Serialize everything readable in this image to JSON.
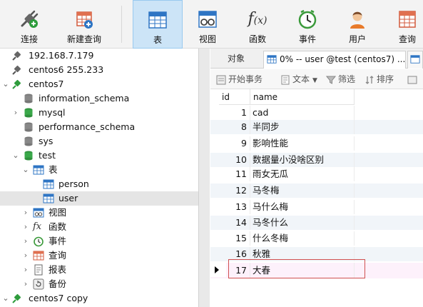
{
  "toolbar": {
    "items": [
      {
        "label": "连接",
        "icon": "connect-plug-icon"
      },
      {
        "label": "新建查询",
        "icon": "new-query-icon"
      },
      {
        "label": "表",
        "icon": "table-icon"
      },
      {
        "label": "视图",
        "icon": "view-icon"
      },
      {
        "label": "函数",
        "icon": "function-icon"
      },
      {
        "label": "事件",
        "icon": "event-clock-icon"
      },
      {
        "label": "用户",
        "icon": "user-icon"
      },
      {
        "label": "查询",
        "icon": "query-icon"
      }
    ],
    "active": "表"
  },
  "tree": {
    "items": [
      {
        "label": "192.168.7.179",
        "icon": "mysql-connection-icon",
        "state": "closed"
      },
      {
        "label": "centos6 255.233",
        "icon": "mysql-connection-icon",
        "state": "closed"
      },
      {
        "label": "centos7",
        "icon": "mysql-connection-icon",
        "state": "open"
      },
      {
        "label": "information_schema",
        "icon": "database-icon",
        "state": "closed"
      },
      {
        "label": "mysql",
        "icon": "database-icon",
        "state": "closed"
      },
      {
        "label": "performance_schema",
        "icon": "database-icon",
        "state": "closed"
      },
      {
        "label": "sys",
        "icon": "database-icon",
        "state": "closed"
      },
      {
        "label": "test",
        "icon": "database-icon",
        "state": "open"
      },
      {
        "label": "表",
        "icon": "table-icon",
        "state": "open"
      },
      {
        "label": "person",
        "icon": "table-icon",
        "state": "leaf"
      },
      {
        "label": "user",
        "icon": "table-icon",
        "state": "selected"
      },
      {
        "label": "视图",
        "icon": "view-icon",
        "state": "closed"
      },
      {
        "label": "函数",
        "icon": "function-icon",
        "state": "closed"
      },
      {
        "label": "事件",
        "icon": "event-clock-icon",
        "state": "closed"
      },
      {
        "label": "查询",
        "icon": "query-icon",
        "state": "closed"
      },
      {
        "label": "报表",
        "icon": "report-icon",
        "state": "closed"
      },
      {
        "label": "备份",
        "icon": "backup-icon",
        "state": "closed"
      },
      {
        "label": "centos7 copy",
        "icon": "mysql-connection-icon",
        "state": "open"
      }
    ]
  },
  "tabs": {
    "objects": "对象",
    "active": "0% -- user @test (centos7) ..."
  },
  "subbar": {
    "begin_transaction": "开始事务",
    "text": "文本",
    "filter": "筛选",
    "sort": "排序"
  },
  "grid": {
    "headers": [
      "id",
      "name"
    ],
    "rows": [
      {
        "id": "1",
        "name": "cad"
      },
      {
        "id": "8",
        "name": "半同步"
      },
      {
        "id": "9",
        "name": "影响性能"
      },
      {
        "id": "10",
        "name": "数据量小没啥区别"
      },
      {
        "id": "11",
        "name": "雨女无瓜"
      },
      {
        "id": "12",
        "name": "马冬梅"
      },
      {
        "id": "13",
        "name": "马什么梅"
      },
      {
        "id": "14",
        "name": "马冬什么"
      },
      {
        "id": "15",
        "name": "什么冬梅"
      },
      {
        "id": "16",
        "name": "秋雅"
      },
      {
        "id": "17",
        "name": "大春"
      }
    ],
    "current_row": "17"
  },
  "colors": {
    "accent": "#cce4f7",
    "db_green": "#3aa84a",
    "table_blue": "#2e75c4",
    "selected_outline": "#d05050"
  }
}
